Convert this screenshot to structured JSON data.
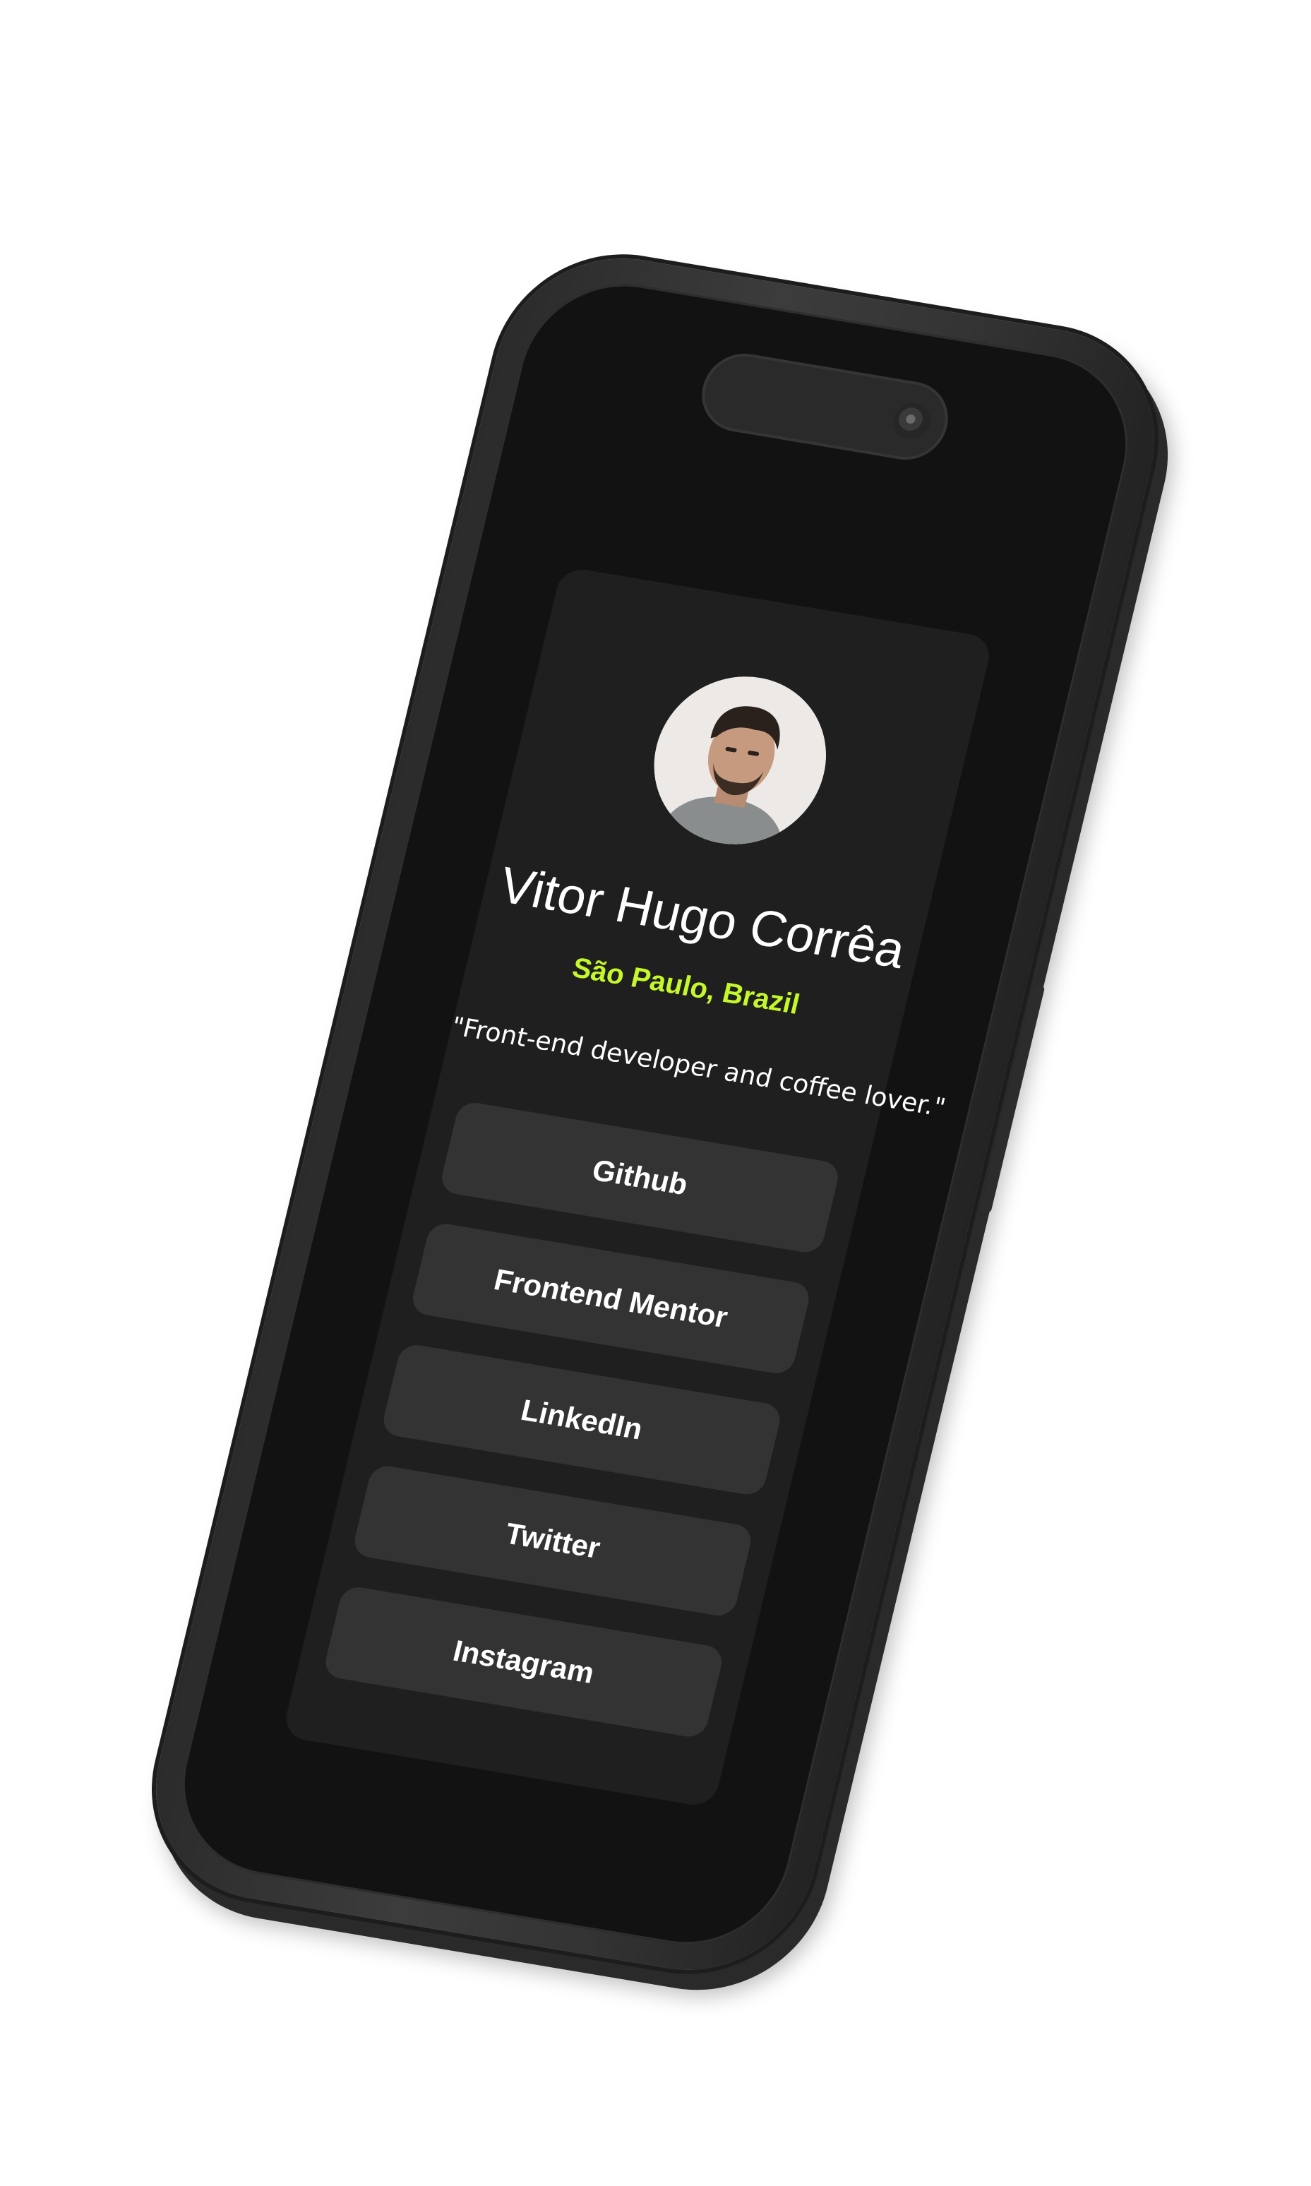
{
  "profile": {
    "name": "Vitor Hugo Corrêa",
    "location": "São Paulo, Brazil",
    "bio": "\"Front-end developer and coffee lover.\""
  },
  "links": [
    {
      "label": "Github"
    },
    {
      "label": "Frontend Mentor"
    },
    {
      "label": "LinkedIn"
    },
    {
      "label": "Twitter"
    },
    {
      "label": "Instagram"
    }
  ],
  "colors": {
    "page_background": "#ffffff",
    "screen_background": "#121212",
    "card_background": "#1f1f1f",
    "button_background": "#333333",
    "accent": "#c4f82a",
    "text": "#ffffff"
  },
  "icons": {
    "avatar": "profile-photo",
    "camera": "front-camera-icon"
  }
}
